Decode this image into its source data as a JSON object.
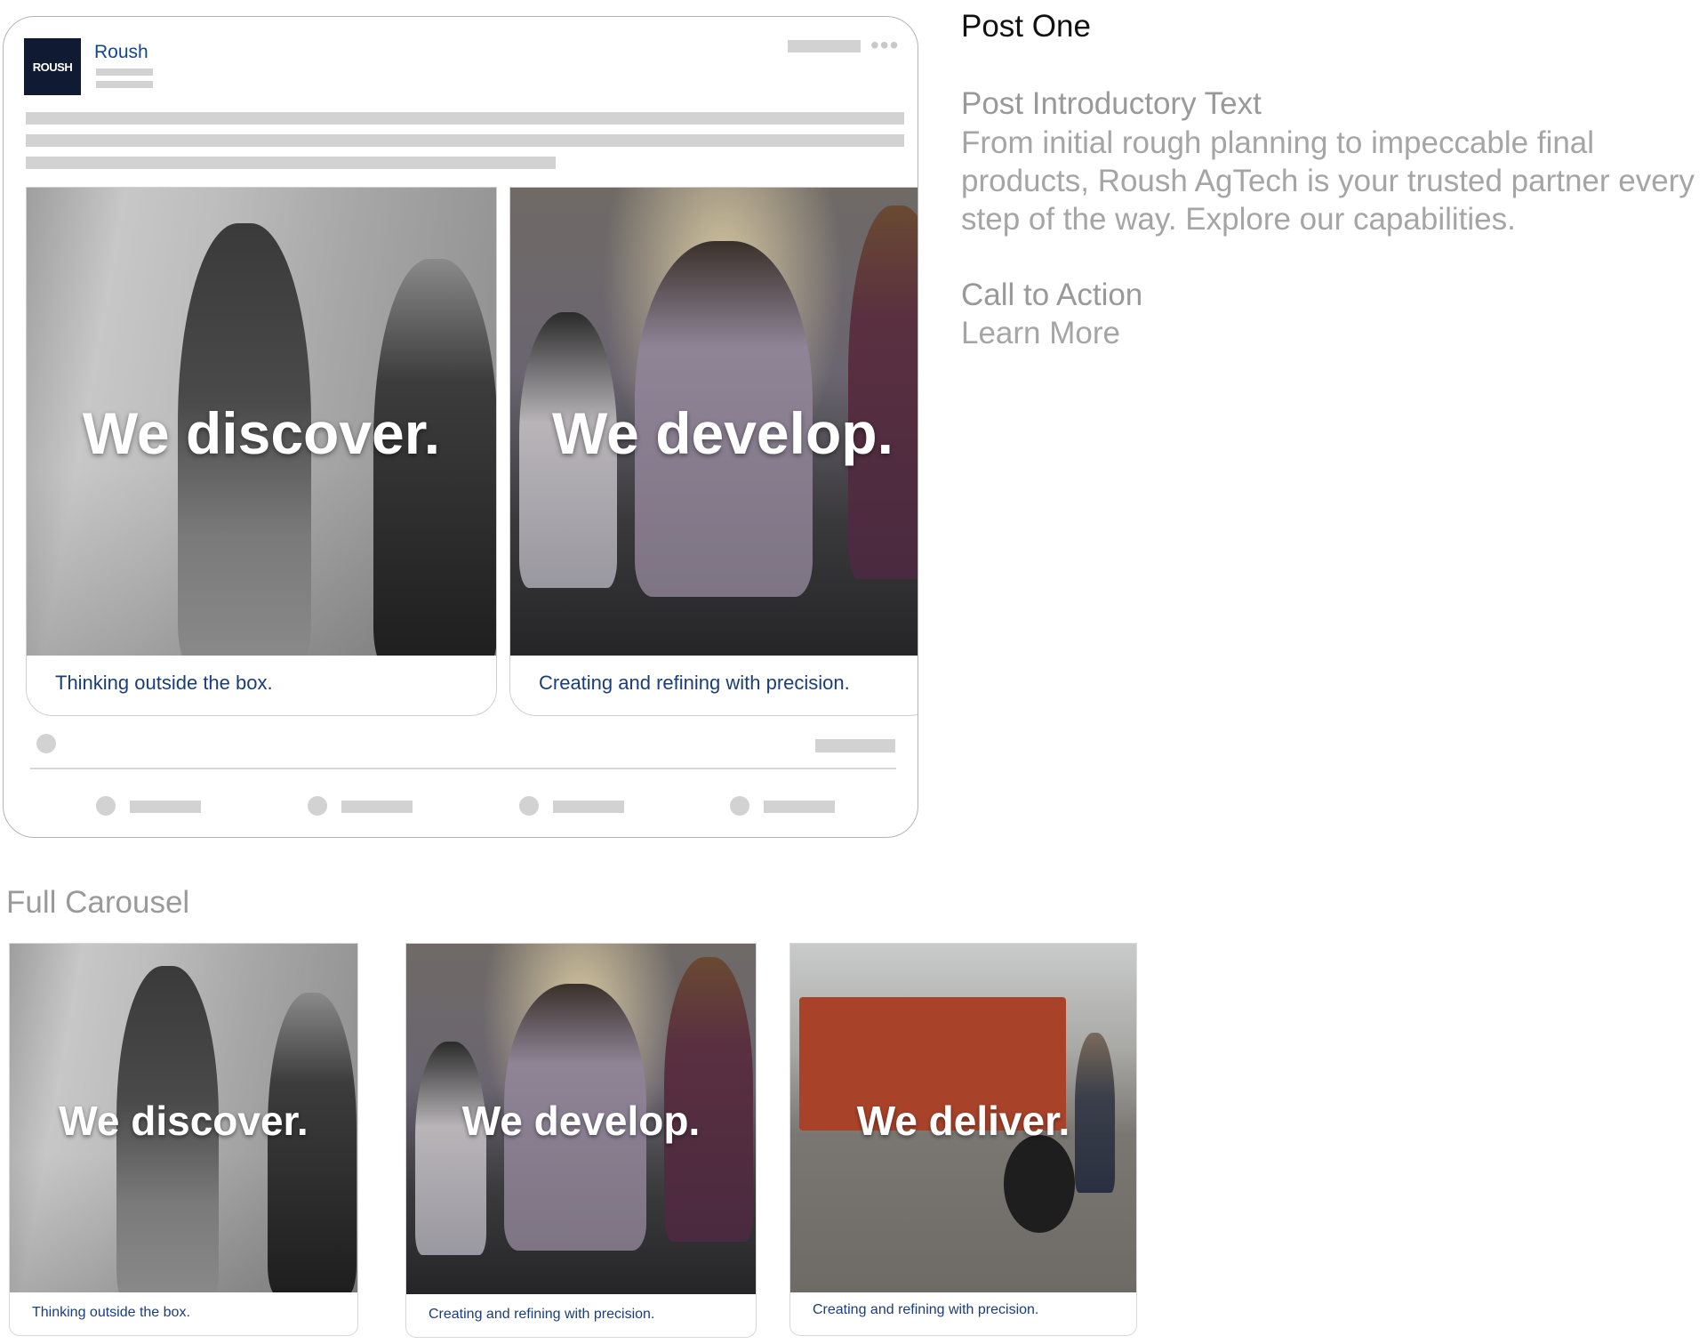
{
  "post": {
    "company_name": "Roush",
    "logo_text": "ROUSH",
    "menu_glyph": "•••",
    "slides": [
      {
        "headline": "We discover.",
        "caption": "Thinking outside the box."
      },
      {
        "headline": "We develop.",
        "caption": "Creating and refining with precision."
      }
    ]
  },
  "details": {
    "title": "Post One",
    "intro_label": "Post Introductory Text",
    "intro_text": "From initial rough planning to impeccable final products, Roush AgTech is your trusted partner every step of the way. Explore our capabilities.",
    "cta_label": "Call to Action",
    "cta_text": "Learn More"
  },
  "carousel": {
    "label": "Full Carousel",
    "slides": [
      {
        "headline": "We discover.",
        "caption": "Thinking outside the box."
      },
      {
        "headline": "We develop.",
        "caption": "Creating and refining with precision."
      },
      {
        "headline": "We deliver.",
        "caption": "Creating and refining with precision."
      }
    ]
  },
  "colors": {
    "brand_navy": "#111a33",
    "caption_blue": "#1a3d7c",
    "company_blue": "#14478a",
    "placeholder_gray": "#d2d2d2"
  }
}
